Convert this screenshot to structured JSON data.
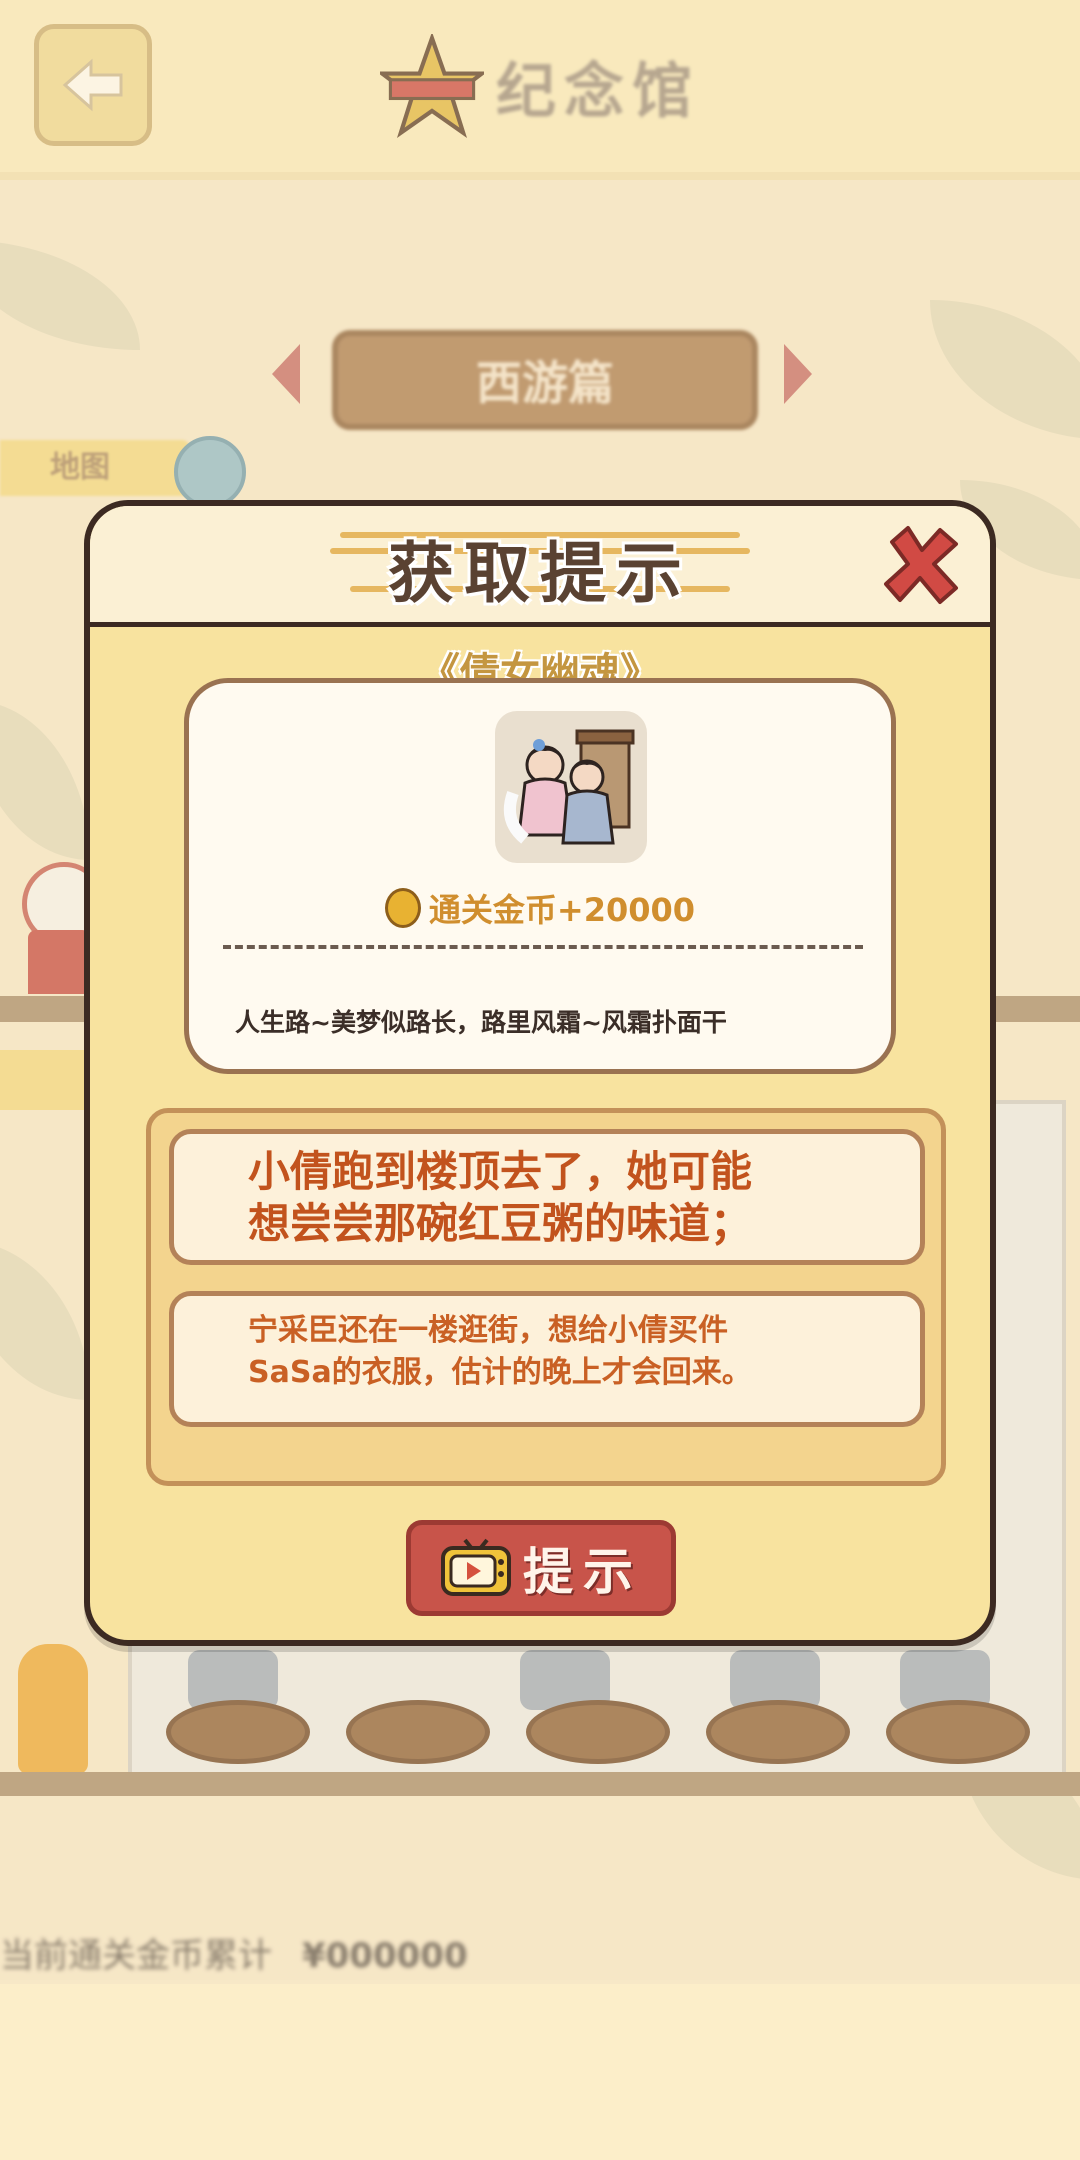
{
  "header": {
    "title": "纪念馆"
  },
  "category": {
    "label": "西游篇"
  },
  "side_tag": {
    "label": "地图"
  },
  "bottom": {
    "label": "当前通关金币累计",
    "value": "¥000000"
  },
  "modal": {
    "title": "获取提示",
    "level_name": "《倩女幽魂》",
    "reward": "通关金币+20000",
    "lyric": "人生路~美梦似路长，路里风霜~风霜扑面干",
    "hints": [
      {
        "line1": "小倩跑到楼顶去了，她可能",
        "line2": "想尝尝那碗红豆粥的味道；"
      },
      {
        "line1": "宁采臣还在一楼逛街，想给小倩买件",
        "line2": "SaSa的衣服，估计的晚上才会回来。"
      }
    ],
    "hint_button": "提示"
  },
  "colors": {
    "modal_bg": "#f8e39f",
    "hint_text": "#c2531d",
    "button": "#c8544a",
    "close": "#d14a44"
  }
}
